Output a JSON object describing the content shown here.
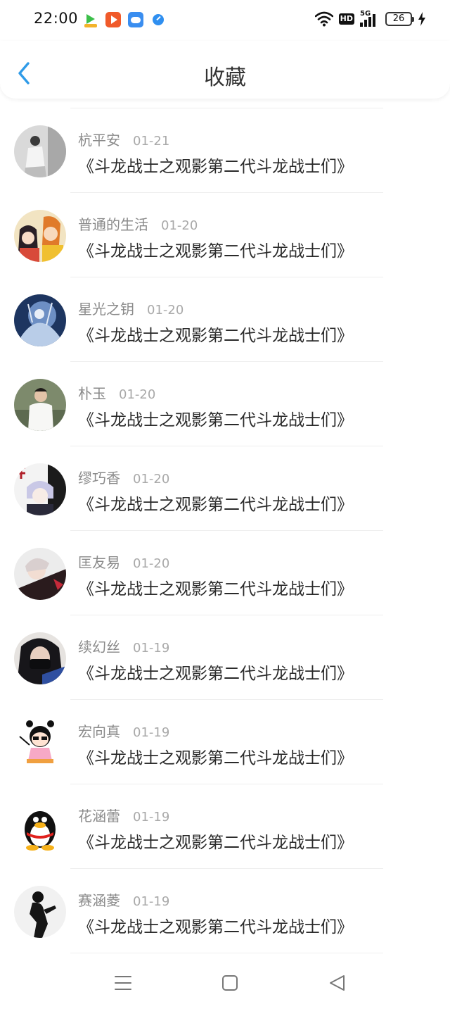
{
  "status_bar": {
    "time": "22:00",
    "app_icons": [
      "green-play-app-icon",
      "video-app-icon",
      "cloud-app-icon",
      "compass-app-icon"
    ],
    "hd": "HD",
    "network": "5G",
    "battery": "26"
  },
  "header": {
    "title": "收藏",
    "accent_color": "#2f9be8"
  },
  "favorites": [
    {
      "username": "杭平安",
      "date": "01-21",
      "work": "《斗龙战士之观影第二代斗龙战士们》",
      "avatar": "photo-avatar"
    },
    {
      "username": "普通的生活",
      "date": "01-20",
      "work": "《斗龙战士之观影第二代斗龙战士们》",
      "avatar": "anime-avatar"
    },
    {
      "username": "星光之钥",
      "date": "01-20",
      "work": "《斗龙战士之观影第二代斗龙战士们》",
      "avatar": "fantasy-avatar"
    },
    {
      "username": "朴玉",
      "date": "01-20",
      "work": "《斗龙战士之观影第二代斗龙战士们》",
      "avatar": "photo-avatar"
    },
    {
      "username": "缪巧香",
      "date": "01-20",
      "work": "《斗龙战士之观影第二代斗龙战士们》",
      "avatar": "anime-avatar"
    },
    {
      "username": "匡友易",
      "date": "01-20",
      "work": "《斗龙战士之观影第二代斗龙战士们》",
      "avatar": "photo-avatar"
    },
    {
      "username": "续幻丝",
      "date": "01-19",
      "work": "《斗龙战士之观影第二代斗龙战士们》",
      "avatar": "photo-avatar"
    },
    {
      "username": "宏向真",
      "date": "01-19",
      "work": "《斗龙战士之观影第二代斗龙战士们》",
      "avatar": "cartoon-girl-avatar"
    },
    {
      "username": "花涵蕾",
      "date": "01-19",
      "work": "《斗龙战士之观影第二代斗龙战士们》",
      "avatar": "penguin-avatar"
    },
    {
      "username": "赛涵菱",
      "date": "01-19",
      "work": "《斗龙战士之观影第二代斗龙战士们》",
      "avatar": "silhouette-avatar"
    }
  ],
  "nav_bar": {
    "icons": [
      "menu-icon",
      "home-icon",
      "back-triangle-icon"
    ]
  }
}
